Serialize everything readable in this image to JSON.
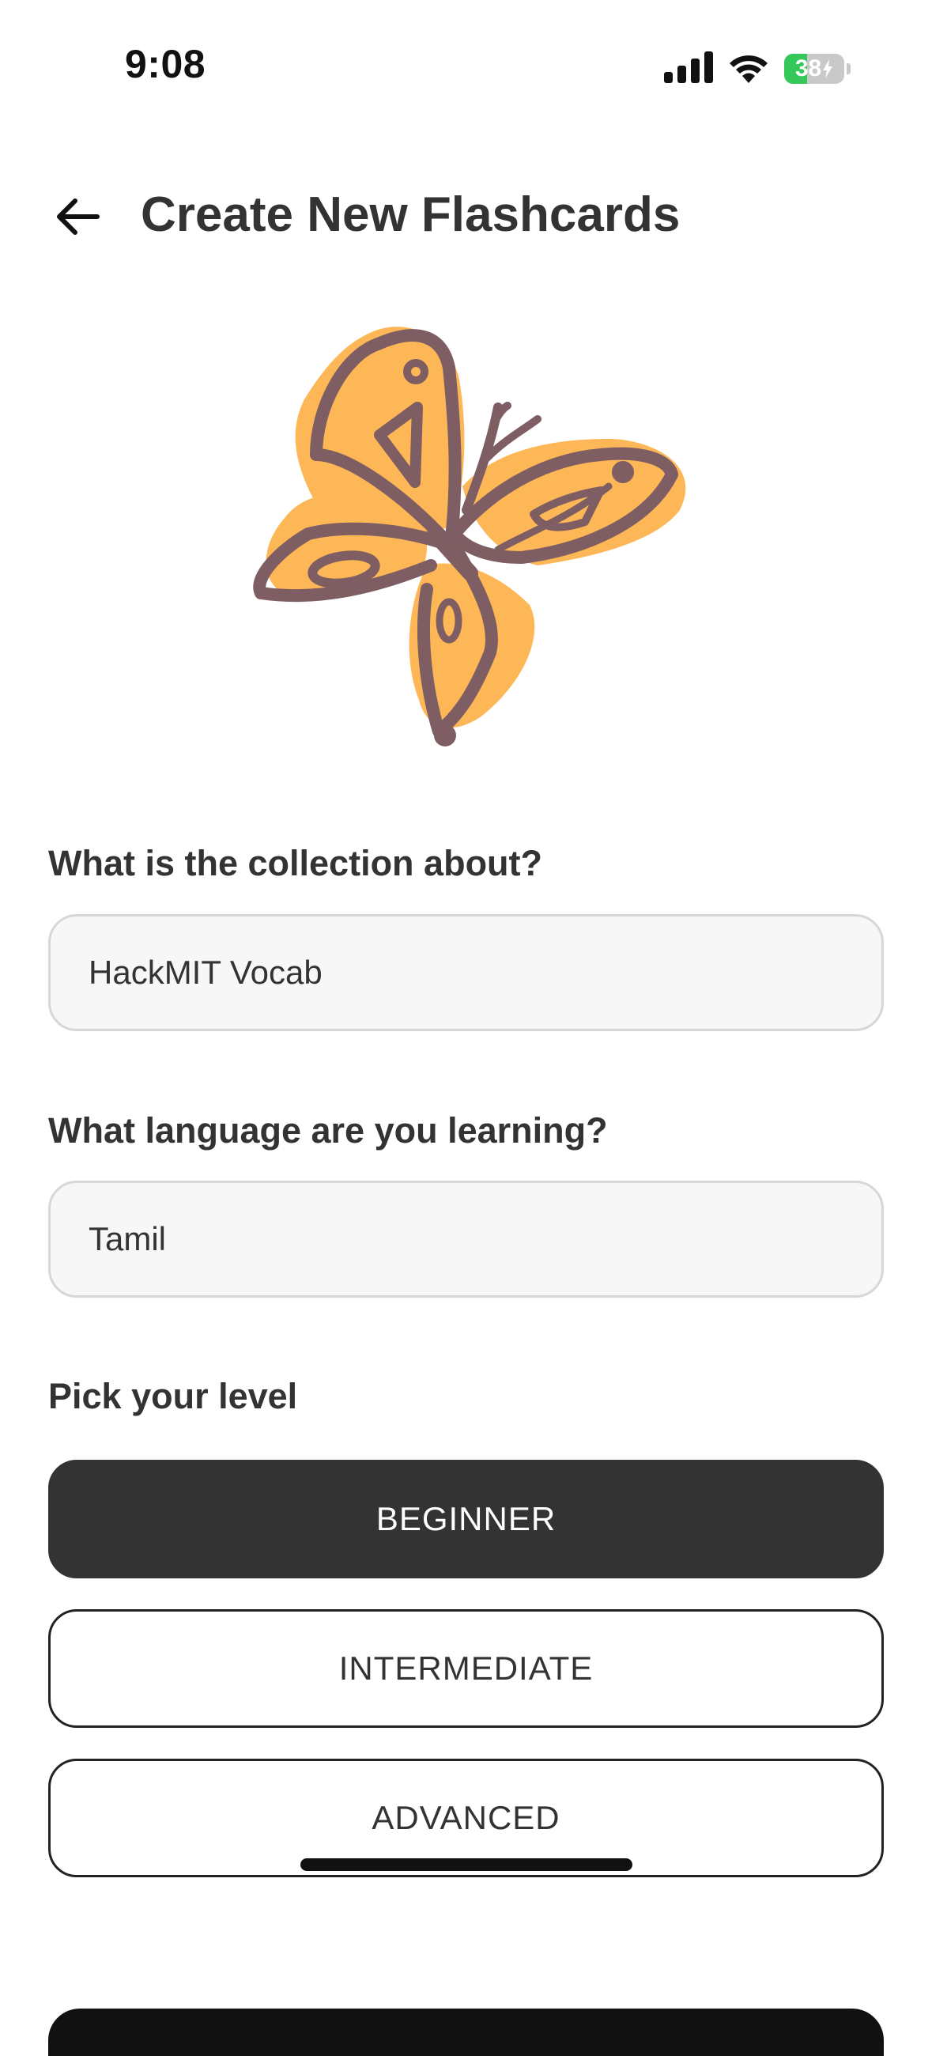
{
  "status_bar": {
    "time": "9:08",
    "battery_percent": "38",
    "battery_level": 0.38,
    "icons": [
      "cellular-signal-icon",
      "wifi-icon",
      "battery-charging-icon"
    ]
  },
  "header": {
    "back_icon": "arrow-left-icon",
    "title": "Create New Flashcards"
  },
  "illustration": {
    "name": "butterfly-illustration",
    "colors": {
      "wing_fill": "#FDB756",
      "outline": "#7E5D63"
    }
  },
  "form": {
    "collection": {
      "label": "What is the collection about?",
      "value": "HackMIT Vocab"
    },
    "language": {
      "label": "What language are you learning?",
      "value": "Tamil"
    },
    "level": {
      "label": "Pick your level",
      "options": [
        {
          "label": "BEGINNER",
          "selected": true
        },
        {
          "label": "INTERMEDIATE",
          "selected": false
        },
        {
          "label": "ADVANCED",
          "selected": false
        }
      ]
    }
  },
  "colors": {
    "primary_dark": "#333333",
    "field_background": "#F7F7F7",
    "field_border": "#D7D7D7",
    "battery_green": "#34C759"
  }
}
